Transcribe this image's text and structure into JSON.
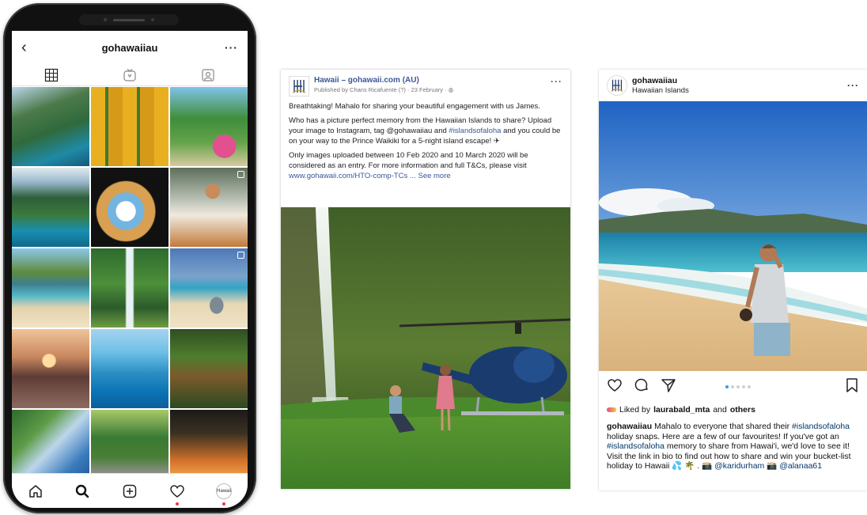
{
  "colors": {
    "facebook_link": "#365899",
    "instagram_blue": "#3897f0",
    "heart_dot": "#e63946"
  },
  "phone": {
    "username": "gohawaiiau",
    "back_icon": "chevron-left-icon",
    "more_label": "···",
    "tabs": [
      "grid-icon",
      "igtv-icon",
      "tagged-icon"
    ],
    "bottom_nav": [
      "home-icon",
      "search-icon",
      "add-post-icon",
      "heart-icon",
      "profile-avatar"
    ],
    "profile_avatar_text": "Hawaii"
  },
  "facebook": {
    "page_name": "Hawaii – gohawaii.com (AU)",
    "meta": "Published by Chans Ricafuente (?) · 23 February · ",
    "more_label": "···",
    "paragraph1": "Breathtaking! Mahalo for sharing your beautiful engagement with us James.",
    "paragraph2": "Who has a picture perfect memory from the Hawaiian Islands to share? Upload your image to Instagram, tag @gohawaiiau and ",
    "hashtag": "#islandsofaloha",
    "paragraph2_tail": " and you could be on your way to the Prince Waikiki for a 5-night island escape! ✈",
    "paragraph3": "Only images uploaded between 10 Feb 2020 and 10 March 2020 will be considered as an entry. For more information and full T&Cs, please visit ",
    "link": "www.gohawaii.com/HTO-comp-TCs",
    "see_more": " ... See more"
  },
  "instagram_post": {
    "username": "gohawaiiau",
    "location": "Hawaiian Islands",
    "more_label": "···",
    "likes_prefix": "Liked by ",
    "likes_user": "laurabald_mta",
    "likes_and": " and ",
    "likes_others": "others",
    "caption_user": "gohawaiiau",
    "caption_1": " Mahalo to everyone that shared their ",
    "caption_tag1": "#islandsofaloha",
    "caption_2": " holiday snaps. Here are a few of our favourites! If you've got an ",
    "caption_tag2": "#islandsofaloha",
    "caption_3": " memory to share from Hawai'i, we'd love to see it! Visit the link in bio to find out how to share and win your bucket-list holiday to Hawaii 💦 🌴 . 📸 ",
    "caption_mention1": "@karidurham",
    "caption_4": " 📸 ",
    "caption_mention2": "@alanaa61"
  }
}
